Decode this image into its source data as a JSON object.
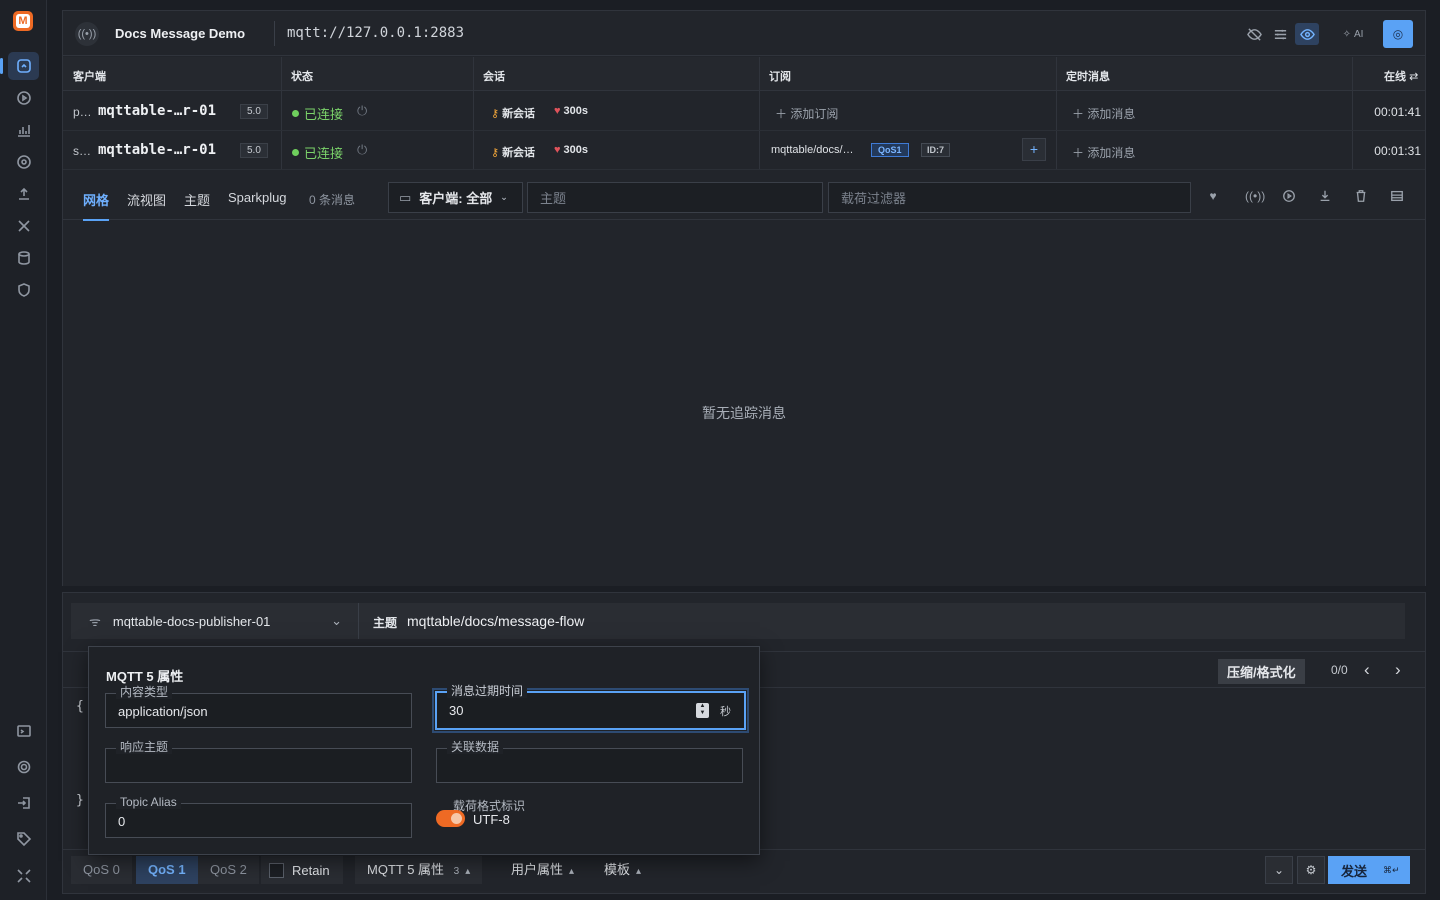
{
  "connection": {
    "name": "Docs Message Demo",
    "url": "mqtt://127.0.0.1:2883",
    "ai_label": "AI"
  },
  "table": {
    "headers": {
      "client": "客户端",
      "status": "状态",
      "session": "会话",
      "subscription": "订阅",
      "scheduled": "定时消息",
      "online": "在线"
    },
    "rows": [
      {
        "prefix": "p…",
        "name": "mqttable-…r-01",
        "version": "5.0",
        "status": "已连接",
        "session": "新会话",
        "expiry": "300s",
        "subscription_add": "添加订阅",
        "scheduled_add": "添加消息",
        "online_time": "00:01:41"
      },
      {
        "prefix": "s…",
        "name": "mqttable-…r-01",
        "version": "5.0",
        "status": "已连接",
        "session": "新会话",
        "expiry": "300s",
        "subscription_topic": "mqttable/docs/…",
        "subscription_qos": "QoS1",
        "subscription_id": "ID:7",
        "scheduled_add": "添加消息",
        "online_time": "00:01:31"
      }
    ]
  },
  "tabs": {
    "grid": "网格",
    "flow": "流视图",
    "topic": "主题",
    "sparkplug": "Sparkplug",
    "message_count": "0 条消息"
  },
  "filters": {
    "client_filter": "客户端: 全部",
    "topic_placeholder": "主题",
    "payload_placeholder": "载荷过滤器"
  },
  "messages": {
    "empty": "暂无追踪消息"
  },
  "publish": {
    "client": "mqttable-docs-publisher-01",
    "topic_label": "主题",
    "topic": "mqttable/docs/message-flow",
    "format_button": "压缩/格式化",
    "search_count": "0/0",
    "editor_open": "{",
    "editor_close": "}",
    "qos": [
      "QoS 0",
      "QoS 1",
      "QoS 2"
    ],
    "qos_selected": 1,
    "retain": "Retain",
    "mqtt5_menu": "MQTT 5 属性",
    "mqtt5_count": "3",
    "user_props_menu": "用户属性",
    "template_menu": "模板",
    "send": "发送",
    "send_shortcut": "⌘↵"
  },
  "mqtt5_popup": {
    "title": "MQTT 5 属性",
    "content_type_label": "内容类型",
    "content_type": "application/json",
    "expiry_label": "消息过期时间",
    "expiry": "30",
    "expiry_unit": "秒",
    "response_topic_label": "响应主题",
    "response_topic": "",
    "correlation_label": "关联数据",
    "correlation": "",
    "topic_alias_label": "Topic Alias",
    "topic_alias": "0",
    "payload_format_label": "载荷格式标识",
    "payload_format": "UTF-8",
    "payload_format_on": true
  },
  "colors": {
    "accent": "#5aa2f5",
    "brand": "#ee6a24",
    "connected": "#7bd36a"
  }
}
